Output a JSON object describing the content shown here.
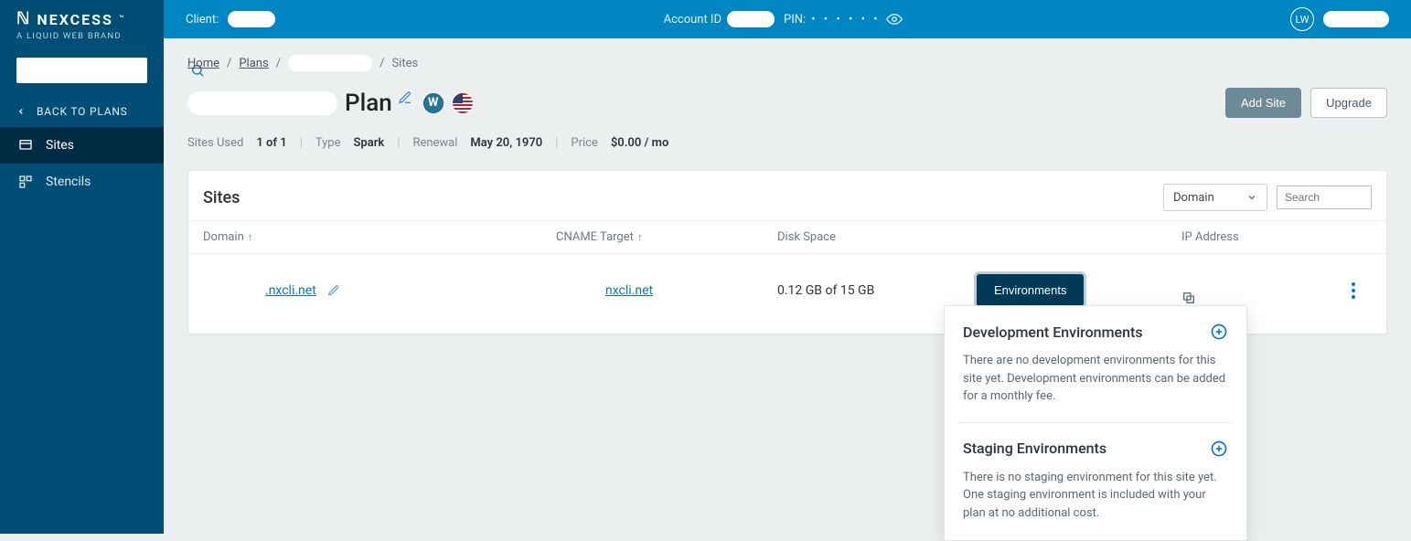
{
  "brand": {
    "name": "NEXCESS",
    "tagline": "A LIQUID WEB BRAND"
  },
  "topbar": {
    "client_label": "Client:",
    "account_label": "Account ID",
    "pin_label": "PIN:",
    "pin_mask": "• • • • • •",
    "avatar_initials": "LW"
  },
  "sidebar": {
    "back_label": "BACK TO PLANS",
    "items": [
      {
        "label": "Sites"
      },
      {
        "label": "Stencils"
      }
    ]
  },
  "breadcrumb": {
    "home": "Home",
    "plans": "Plans",
    "current": "Sites"
  },
  "page": {
    "plan_word": "Plan",
    "actions": {
      "add_site": "Add Site",
      "upgrade": "Upgrade"
    },
    "meta": {
      "sites_used_label": "Sites Used",
      "sites_used_value": "1 of 1",
      "type_label": "Type",
      "type_value": "Spark",
      "renewal_label": "Renewal",
      "renewal_value": "May 20, 1970",
      "price_label": "Price",
      "price_value": "$0.00 / mo"
    }
  },
  "sites_card": {
    "title": "Sites",
    "filter_select": "Domain",
    "search_placeholder": "Search",
    "columns": {
      "domain": "Domain",
      "cname": "CNAME Target",
      "disk": "Disk Space",
      "ip": "IP Address"
    },
    "row": {
      "domain": ".nxcli.net",
      "cname": "nxcli.net",
      "disk": "0.12 GB of 15 GB",
      "env_button": "Environments"
    }
  },
  "popover": {
    "dev_title": "Development Environments",
    "dev_text": "There are no development environments for this site yet. Development environments can be added for a monthly fee.",
    "stg_title": "Staging Environments",
    "stg_text": "There is no staging environment for this site yet. One staging environment is included with your plan at no additional cost."
  }
}
